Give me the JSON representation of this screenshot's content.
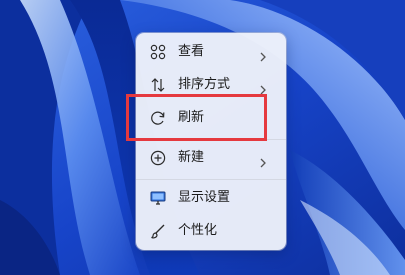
{
  "context_menu": {
    "items": [
      {
        "label": "查看",
        "icon": "grid-icon",
        "submenu": true
      },
      {
        "label": "排序方式",
        "icon": "sort-arrows-icon",
        "submenu": true
      },
      {
        "label": "刷新",
        "icon": "refresh-icon",
        "submenu": false
      },
      {
        "label": "新建",
        "icon": "plus-circle-icon",
        "submenu": true
      },
      {
        "label": "显示设置",
        "icon": "monitor-icon",
        "submenu": false
      },
      {
        "label": "个性化",
        "icon": "brush-icon",
        "submenu": false
      }
    ]
  },
  "highlight": {
    "target": "刷新",
    "color": "#e5393f"
  },
  "colors": {
    "menu_background": "#eef1fa",
    "wallpaper_dark": "#0b2fa8",
    "wallpaper_light": "#9fc3ff",
    "highlight_border": "#e5393f"
  }
}
